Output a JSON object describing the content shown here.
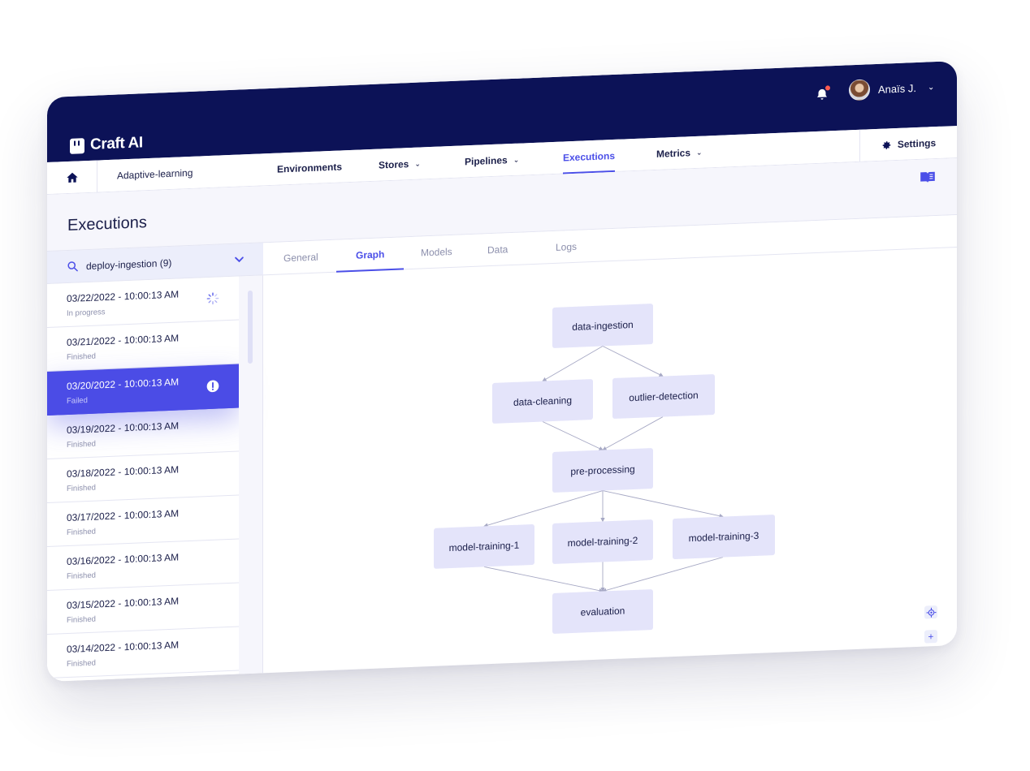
{
  "app": {
    "brand": "Craft AI"
  },
  "topbar": {
    "user_name": "Anaïs J."
  },
  "nav": {
    "project": "Adaptive-learning",
    "items": [
      "Environments",
      "Stores",
      "Pipelines",
      "Executions",
      "Metrics"
    ],
    "settings_label": "Settings"
  },
  "page": {
    "title": "Executions"
  },
  "search": {
    "value": "deploy-ingestion (9)"
  },
  "executions": [
    {
      "time": "03/22/2022 - 10:00:13 AM",
      "status": "In progress"
    },
    {
      "time": "03/21/2022 - 10:00:13 AM",
      "status": "Finished"
    },
    {
      "time": "03/20/2022 - 10:00:13 AM",
      "status": "Failed"
    },
    {
      "time": "03/19/2022 - 10:00:13 AM",
      "status": "Finished"
    },
    {
      "time": "03/18/2022 - 10:00:13 AM",
      "status": "Finished"
    },
    {
      "time": "03/17/2022 - 10:00:13 AM",
      "status": "Finished"
    },
    {
      "time": "03/16/2022 - 10:00:13 AM",
      "status": "Finished"
    },
    {
      "time": "03/15/2022 - 10:00:13 AM",
      "status": "Finished"
    },
    {
      "time": "03/14/2022 - 10:00:13 AM",
      "status": "Finished"
    }
  ],
  "tabs": [
    "General",
    "Graph",
    "Models",
    "Data",
    "Logs"
  ],
  "graph": {
    "nodes": [
      "data-ingestion",
      "data-cleaning",
      "outlier-detection",
      "pre-processing",
      "model-training-1",
      "model-training-2",
      "model-training-3",
      "evaluation"
    ]
  },
  "controls": {
    "zoom_in": "+",
    "zoom_out": "−"
  }
}
